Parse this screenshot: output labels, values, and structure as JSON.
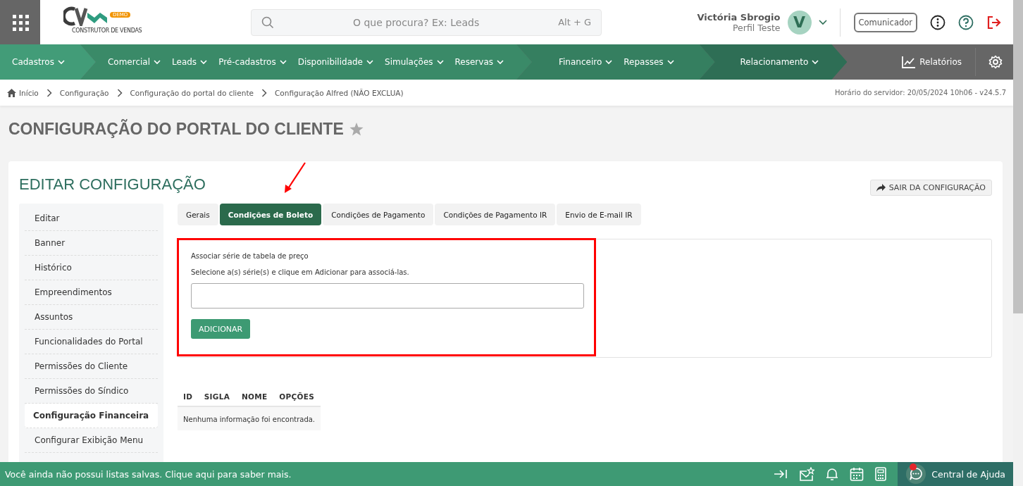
{
  "logo": {
    "badge": "DEMO",
    "tagline": "CONSTRUTOR DE VENDAS"
  },
  "search": {
    "placeholder": "O que procura? Ex: Leads",
    "shortcut": "Alt + G"
  },
  "user": {
    "name": "Victória Sbrogio",
    "profile": "Perfil Teste",
    "initial": "V"
  },
  "communicator": "Comunicador",
  "nav": [
    {
      "items": [
        "Cadastros"
      ]
    },
    {
      "items": [
        "Comercial",
        "Leads",
        "Pré-cadastros",
        "Disponibilidade",
        "Simulações",
        "Reservas"
      ]
    },
    {
      "items": [
        "Financeiro",
        "Repasses"
      ]
    },
    {
      "items": [
        "Relacionamento"
      ]
    }
  ],
  "reports": "Relatórios",
  "breadcrumb": [
    "Início",
    "Configuração",
    "Configuração do portal do cliente",
    "Configuração Alfred (NÃO EXCLUA)"
  ],
  "server_time": "Horário do servidor: 20/05/2024 10h06 - v24.5.7",
  "page_title": "CONFIGURAÇÃO DO PORTAL DO CLIENTE",
  "card_title": "EDITAR CONFIGURAÇÃO",
  "exit_button": "SAIR DA CONFIGURAÇÃO",
  "sidebar": [
    {
      "label": "Editar",
      "selected": false
    },
    {
      "label": "Banner",
      "selected": false
    },
    {
      "label": "Histórico",
      "selected": false
    },
    {
      "label": "Empreendimentos",
      "selected": false
    },
    {
      "label": "Assuntos",
      "selected": false
    },
    {
      "label": "Funcionalidades do Portal",
      "selected": false
    },
    {
      "label": "Permissões do Cliente",
      "selected": false
    },
    {
      "label": "Permissões do Síndico",
      "selected": false
    },
    {
      "label": "Configuração Financeira",
      "selected": true
    },
    {
      "label": "Configurar Exibição Menu",
      "selected": false
    }
  ],
  "tabs": [
    {
      "label": "Gerais",
      "selected": false
    },
    {
      "label": "Condições de Boleto",
      "selected": true
    },
    {
      "label": "Condições de Pagamento",
      "selected": false
    },
    {
      "label": "Condições de Pagamento IR",
      "selected": false
    },
    {
      "label": "Envio de E-mail IR",
      "selected": false
    }
  ],
  "form": {
    "title": "Associar série de tabela de preço",
    "hint": "Selecione a(s) série(s) e clique em Adicionar para associá-las.",
    "button": "ADICIONAR"
  },
  "table": {
    "columns": [
      "ID",
      "SIGLA",
      "NOME",
      "OPÇÕES"
    ],
    "empty": "Nenhuma informação foi encontrada."
  },
  "footer": {
    "message": "Você ainda não possui listas salvas. Clique aqui para saber mais.",
    "help": "Central de Ajuda"
  }
}
